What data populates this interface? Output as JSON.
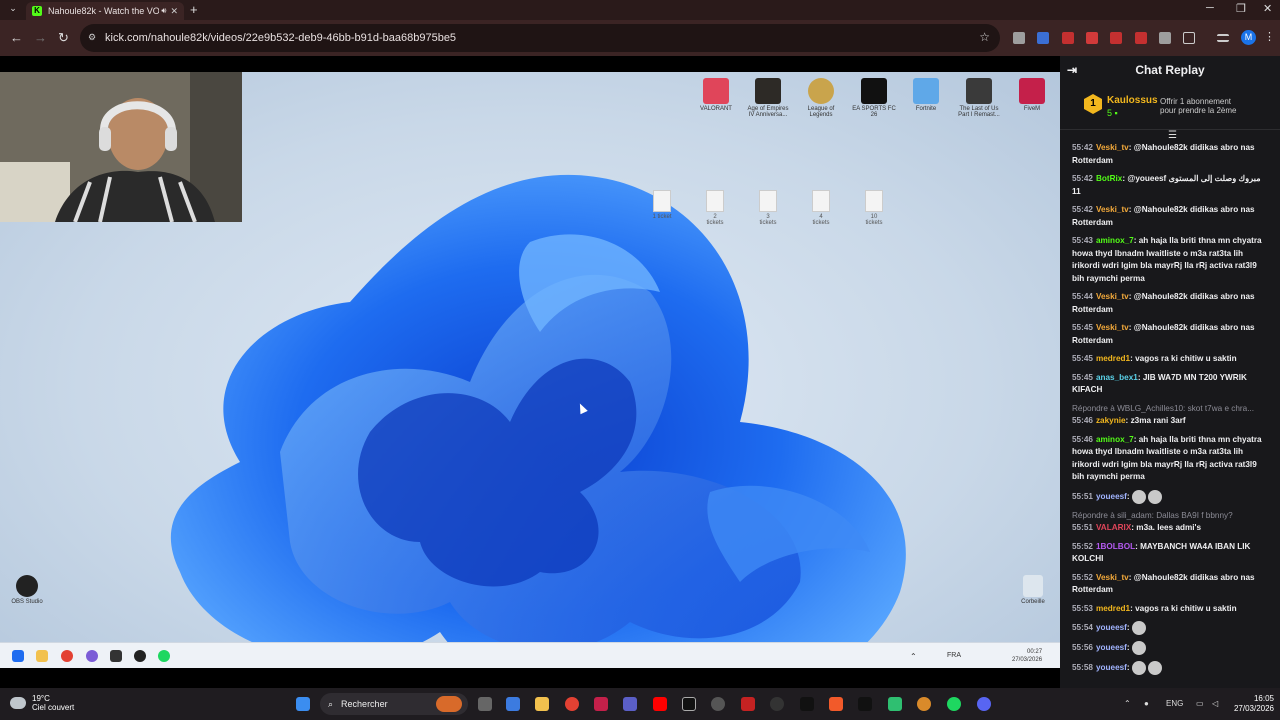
{
  "browser": {
    "tab_title": "Nahoule82k - Watch the VO",
    "url": "kick.com/nahoule82k/videos/22e9b532-deb9-46bb-b91d-baa68b975be5",
    "profile_initial": "M"
  },
  "desktop": {
    "top_icons": [
      {
        "label": "VALORANT",
        "color": "#e0455a"
      },
      {
        "label": "Age of Empires IV Anniversa...",
        "color": "#2d2a26"
      },
      {
        "label": "League of Legends",
        "color": "#c9a44c"
      },
      {
        "label": "EA SPORTS FC 26",
        "color": "#111111"
      },
      {
        "label": "Fortnite",
        "color": "#5fa8e8"
      },
      {
        "label": "The Last of Us Part I Remast...",
        "color": "#3a3a3a"
      },
      {
        "label": "FiveM",
        "color": "#c4204a"
      }
    ],
    "file_icons": [
      "1 ticket",
      "2 tickets",
      "3 tickets",
      "4 tickets",
      "10 tickets"
    ],
    "left_icon_label": "OBS Studio",
    "right_icon_label": "Corbeille",
    "inner_taskbar": {
      "lang": "FRA",
      "time": "00:27",
      "date": "27/03/2026"
    }
  },
  "chat": {
    "title": "Chat Replay",
    "pinned": {
      "name": "Kaulossus",
      "count": "5",
      "level": "1",
      "gift_text_1": "Offrir 1 abonnement",
      "gift_text_2": "pour prendre la 2ème"
    },
    "messages": [
      {
        "time": "55:42",
        "user": "Veski_tv",
        "color": "#f2a93b",
        "text": "@Nahoule82k didikas abro nas Rotterdam"
      },
      {
        "time": "55:42",
        "user": "BotRix",
        "color": "#53fc18",
        "text": "@youeesf مبروك وصلت إلى المستوى 11"
      },
      {
        "time": "55:42",
        "user": "Veski_tv",
        "color": "#f2a93b",
        "text": "@Nahoule82k didikas abro nas Rotterdam"
      },
      {
        "time": "55:43",
        "user": "aminox_7",
        "color": "#53fc18",
        "text": "ah haja lla briti thna mn chyatra howa thyd lbnadm lwaitliste o m3a rat3ta lih irikordi wdri lgim bla mayrRj lla rRj activa rat3l9 bih raymchi perma"
      },
      {
        "time": "55:44",
        "user": "Veski_tv",
        "color": "#f2a93b",
        "text": "@Nahoule82k didikas abro nas Rotterdam"
      },
      {
        "time": "55:45",
        "user": "Veski_tv",
        "color": "#f2a93b",
        "text": "@Nahoule82k didikas abro nas Rotterdam"
      },
      {
        "time": "55:45",
        "user": "medred1",
        "color": "#f2b71e",
        "text": "vagos ra ki chitiw u saktin"
      },
      {
        "time": "55:45",
        "user": "anas_bex1",
        "color": "#5ad1e8",
        "text": "JIB WA7D MN T200 YWRIK KIFACH"
      },
      {
        "time": "55:46",
        "user": "zakynie",
        "color": "#f2b71e",
        "text": "z3ma rani 3arf",
        "reply": "Répondre à WBLG_Achilles10: skot t7wa e chra..."
      },
      {
        "time": "55:46",
        "user": "aminox_7",
        "color": "#53fc18",
        "text": "ah haja lla briti thna mn chyatra howa thyd lbnadm lwaitliste o m3a rat3ta lih irikordi wdri lgim bla mayrRj lla rRj activa rat3l9 bih raymchi perma"
      },
      {
        "time": "55:51",
        "user": "youeesf",
        "color": "#a1b4ff",
        "text": "",
        "emotes": 2
      },
      {
        "time": "55:51",
        "user": "VALARIX",
        "color": "#e0455a",
        "text": "m3a. lees admi's",
        "reply": "Répondre à sili_adam: Dallas BA9I f bbnny?"
      },
      {
        "time": "55:52",
        "user": "1BOLBOL",
        "color": "#b55af2",
        "text": "MAYBANCH WA4A IBAN LIK KOLCHI"
      },
      {
        "time": "55:52",
        "user": "Veski_tv",
        "color": "#f2a93b",
        "text": "@Nahoule82k didikas abro nas Rotterdam"
      },
      {
        "time": "55:53",
        "user": "medred1",
        "color": "#f2b71e",
        "text": "vagos ra ki chitiw u saktin"
      },
      {
        "time": "55:54",
        "user": "youeesf",
        "color": "#a1b4ff",
        "text": "",
        "emotes": 1
      },
      {
        "time": "55:56",
        "user": "youeesf",
        "color": "#a1b4ff",
        "text": "",
        "emotes": 1
      },
      {
        "time": "55:58",
        "user": "youeesf",
        "color": "#a1b4ff",
        "text": "",
        "emotes": 2
      }
    ]
  },
  "taskbar": {
    "weather_temp": "19°C",
    "weather_desc": "Ciel couvert",
    "search_placeholder": "Rechercher",
    "lang": "ENG",
    "time": "16:05",
    "date": "27/03/2026"
  }
}
